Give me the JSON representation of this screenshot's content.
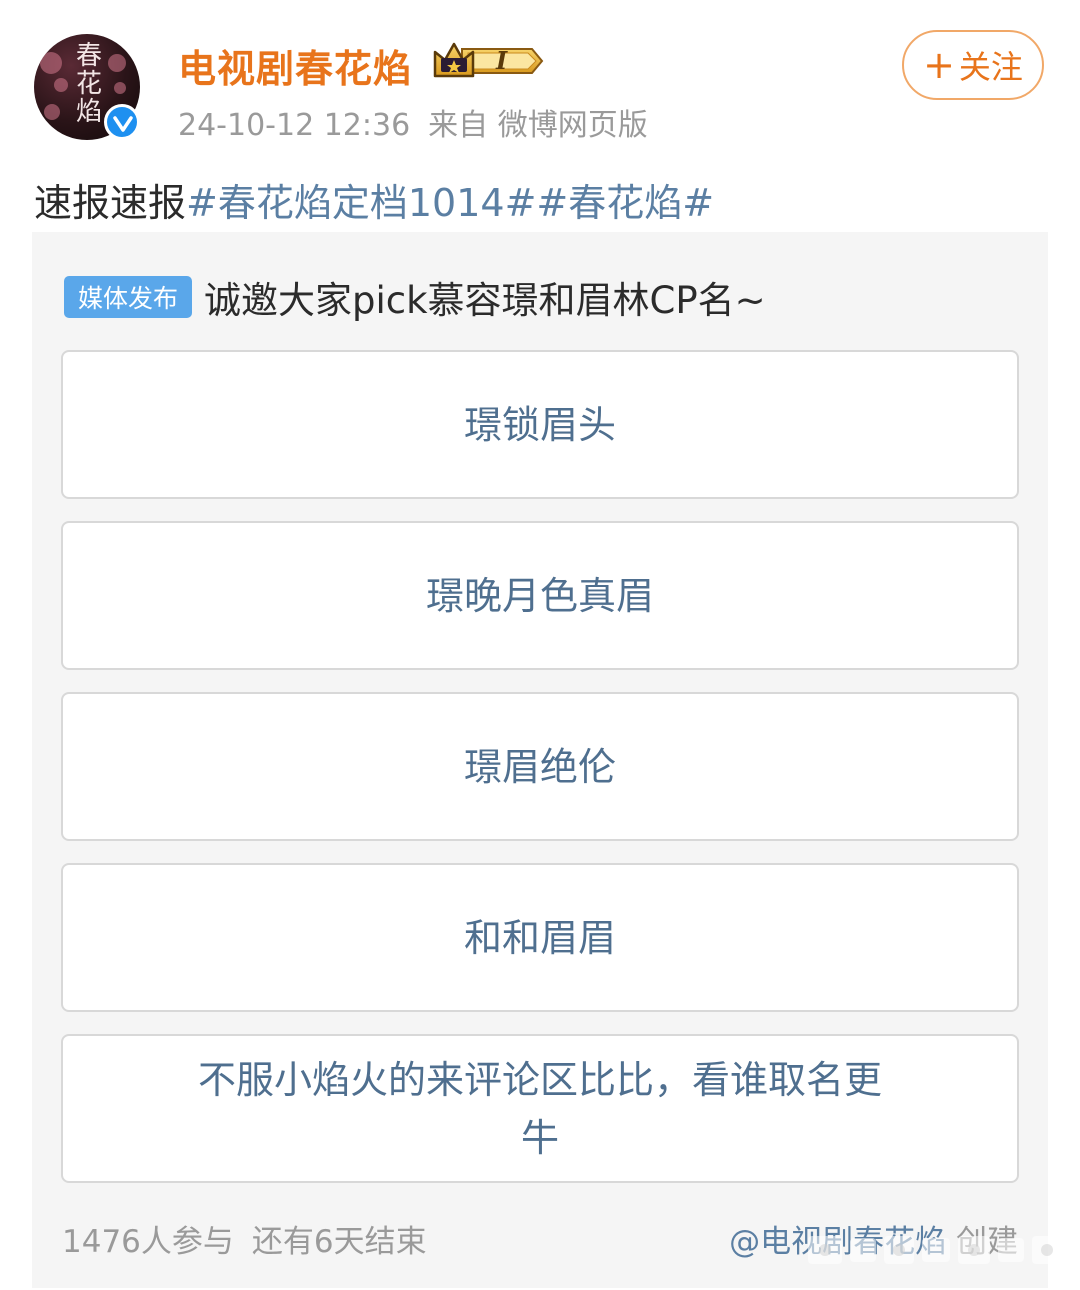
{
  "header": {
    "avatar_text": "春花焰",
    "username": "电视剧春花焰",
    "level_badge": "I",
    "timestamp": "24-10-12 12:36",
    "source": "来自 微博网页版",
    "follow_label": "关注"
  },
  "post": {
    "text": "速报速报",
    "hashtags": [
      "#春花焰定档1014#",
      "#春花焰#"
    ]
  },
  "vote": {
    "tag": "媒体发布",
    "title": "诚邀大家pick慕容璟和眉林CP名~",
    "options": [
      "璟锁眉头",
      "璟晚月色真眉",
      "璟眉绝伦",
      "和和眉眉",
      "不服小焰火的来评论区比比，看谁取名更牛"
    ],
    "participants": "1476人参与",
    "remaining": "还有6天结束",
    "creator": "@电视剧春花焰",
    "creator_suffix": "创建"
  },
  "colors": {
    "username": "#e8741b",
    "hashtag": "#5b7fa3",
    "option_text": "#4f6f8f",
    "tag_bg": "#5aa7ea",
    "verify_blue": "#1e90f0"
  }
}
